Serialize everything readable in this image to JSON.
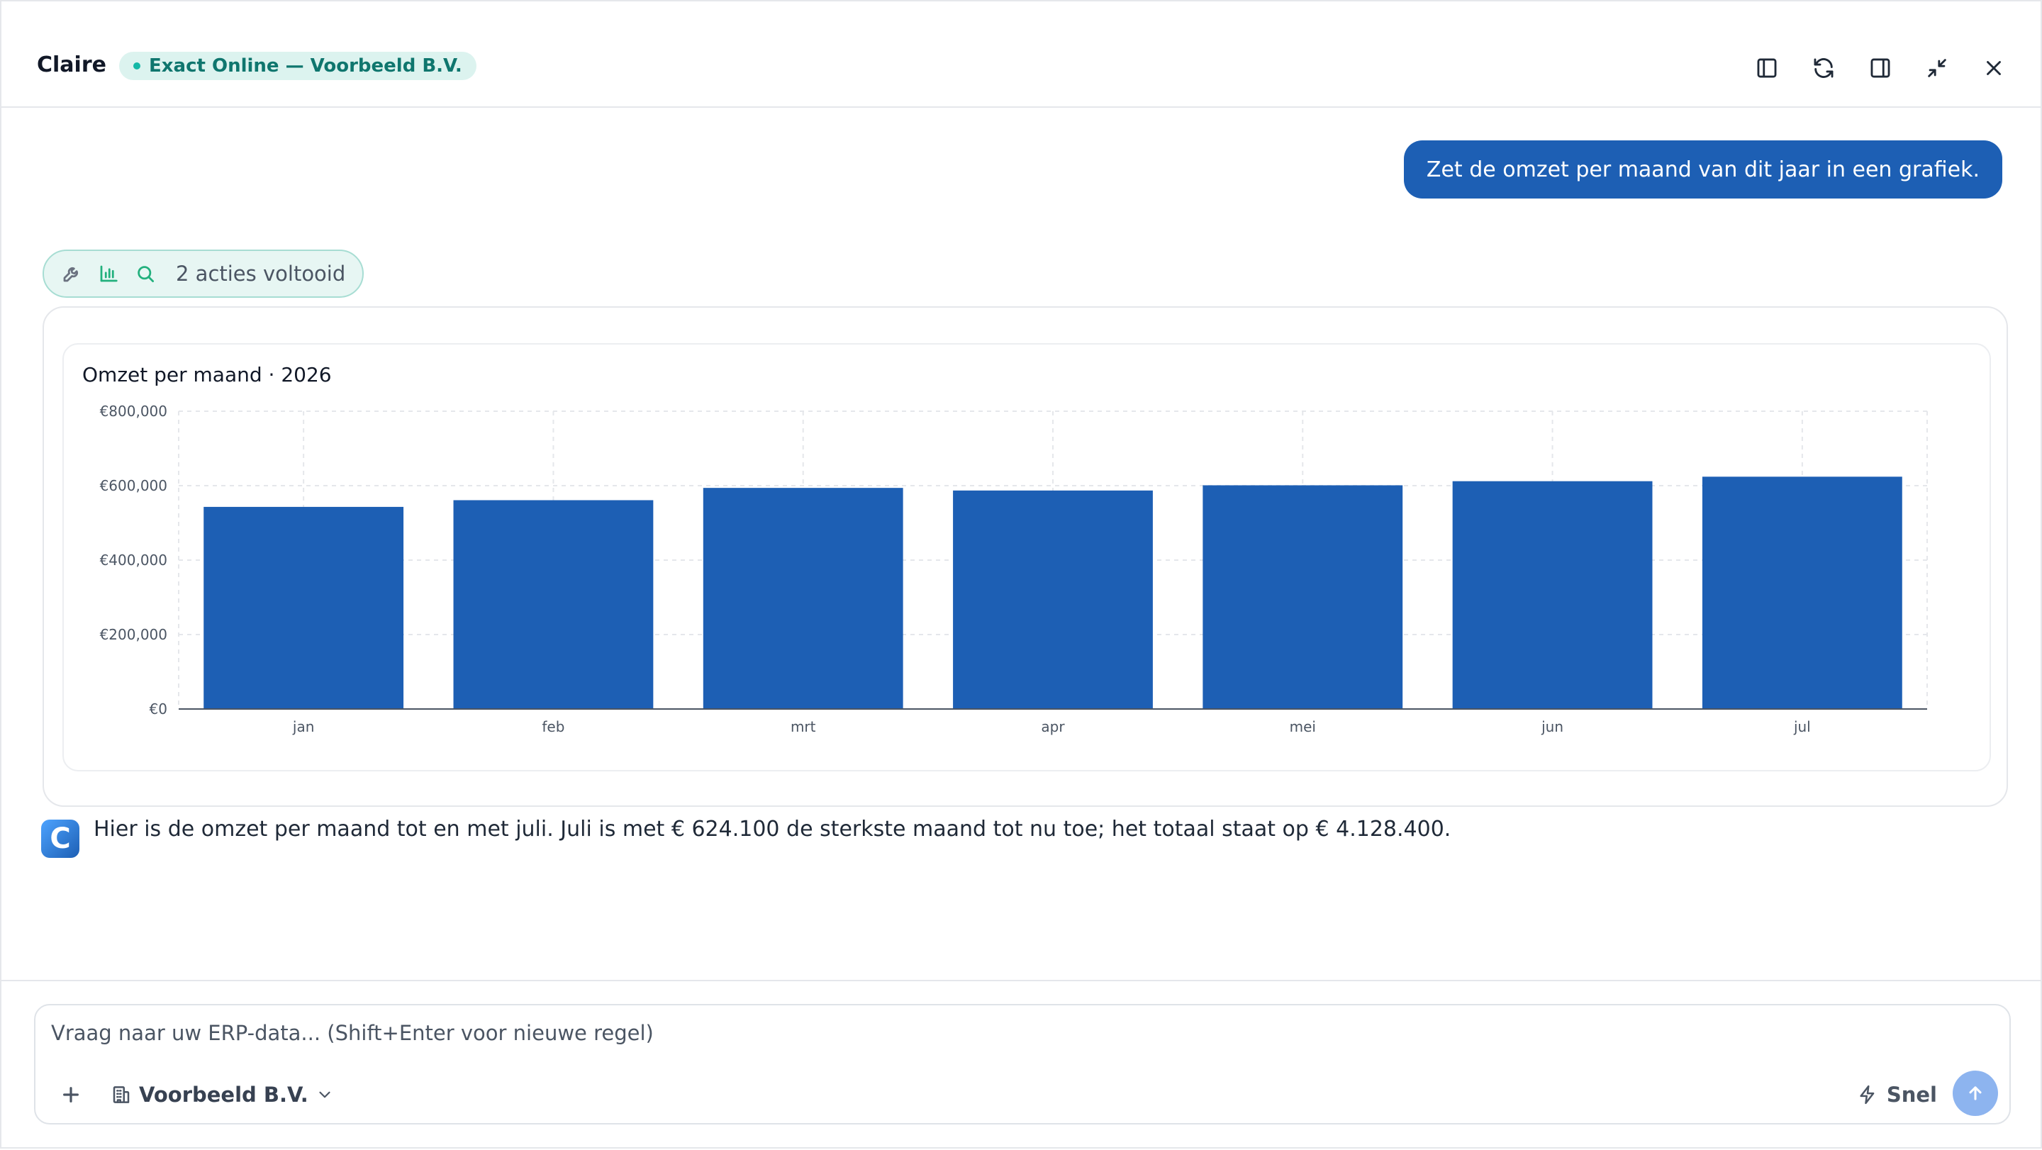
{
  "header": {
    "title": "Claire",
    "connection": "Exact Online — Voorbeeld B.V.",
    "icons": [
      "sidebar-left-icon",
      "refresh-icon",
      "sidebar-right-icon",
      "minimize-icon",
      "close-icon"
    ]
  },
  "conversation": {
    "user_message": "Zet de omzet per maand van dit jaar in een grafiek.",
    "actions_label": "2 acties voltooid",
    "assistant_message": "Hier is de omzet per maand tot en met juli. Juli is met € 624.100 de sterkste maand tot nu toe; het totaal staat op € 4.128.400.",
    "assistant_avatar_letter": "C"
  },
  "chart_data": {
    "type": "bar",
    "title": "Omzet per maand · 2026",
    "xlabel": "",
    "ylabel": "",
    "categories": [
      "jan",
      "feb",
      "mrt",
      "apr",
      "mei",
      "jun",
      "jul"
    ],
    "values": [
      543000,
      561000,
      594000,
      587000,
      601000,
      612000,
      624100
    ],
    "ylim": [
      0,
      800000
    ],
    "yticks": [
      0,
      200000,
      400000,
      600000,
      800000
    ],
    "ytick_labels": [
      "€0",
      "€200,000",
      "€400,000",
      "€600,000",
      "€800,000"
    ],
    "grid": true,
    "bar_color": "#1d5fb4"
  },
  "composer": {
    "placeholder": "Vraag naar uw ERP-data... (Shift+Enter voor nieuwe regel)",
    "value": "",
    "company": "Voorbeeld B.V.",
    "mode": "Snel"
  },
  "colors": {
    "accent": "#1d5fb4",
    "badge_bg": "#dcf3ef",
    "badge_text": "#0f766e",
    "send_button": "#8db4ef"
  }
}
